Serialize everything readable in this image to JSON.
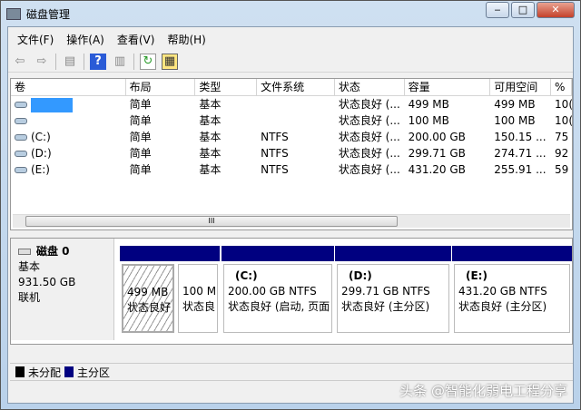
{
  "window": {
    "title": "磁盘管理",
    "min": "‒",
    "max": "□",
    "close": "✕"
  },
  "menu": [
    "文件(F)",
    "操作(A)",
    "查看(V)",
    "帮助(H)"
  ],
  "columns": [
    "卷",
    "布局",
    "类型",
    "文件系统",
    "状态",
    "容量",
    "可用空间",
    "%"
  ],
  "rows": [
    [
      "",
      "简单",
      "基本",
      "",
      "状态良好 (...",
      "499 MB",
      "499 MB",
      "10("
    ],
    [
      "",
      "简单",
      "基本",
      "",
      "状态良好 (...",
      "100 MB",
      "100 MB",
      "10("
    ],
    [
      "(C:)",
      "简单",
      "基本",
      "NTFS",
      "状态良好 (...",
      "200.00 GB",
      "150.15 ...",
      "75"
    ],
    [
      "(D:)",
      "简单",
      "基本",
      "NTFS",
      "状态良好 (...",
      "299.71 GB",
      "274.71 ...",
      "92"
    ],
    [
      "(E:)",
      "简单",
      "基本",
      "NTFS",
      "状态良好 (...",
      "431.20 GB",
      "255.91 ...",
      "59"
    ]
  ],
  "scroll_grip": "III",
  "disk": {
    "name": "磁盘 0",
    "type": "基本",
    "size": "931.50 GB",
    "state": "联机"
  },
  "partitions": [
    {
      "label": "",
      "size": "499 MB",
      "status": "状态良好"
    },
    {
      "label": "",
      "size": "100 M",
      "status": "状态良"
    },
    {
      "label": "(C:)",
      "size": "200.00 GB NTFS",
      "status": "状态良好 (启动, 页面"
    },
    {
      "label": "(D:)",
      "size": "299.71 GB NTFS",
      "status": "状态良好 (主分区)"
    },
    {
      "label": "(E:)",
      "size": "431.20 GB NTFS",
      "status": "状态良好 (主分区)"
    }
  ],
  "legend": [
    {
      "label": "未分配",
      "color": "#000000"
    },
    {
      "label": "主分区",
      "color": "#000080"
    }
  ],
  "watermark": "头条 @智能化弱电工程分享"
}
